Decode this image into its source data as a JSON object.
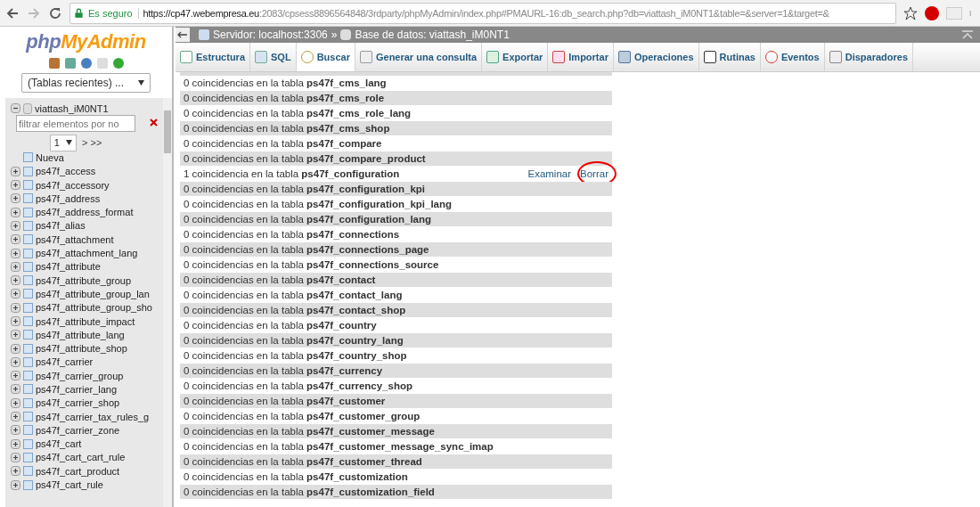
{
  "browser": {
    "security": "Es seguro",
    "url_host": "https://cp47.webempresa.eu",
    "url_rest": ":2083/cpsess8896564848/3rdparty/phpMyAdmin/index.php#PMAURL-16:db_search.php?db=viattash_iM0NT1&table=&server=1&target=&"
  },
  "sidebar": {
    "logo": {
      "prefix": "php",
      "main": "MyAdmin"
    },
    "recent": "(Tablas recientes) ...",
    "database": "viattash_iM0NT1",
    "expanded": true,
    "filter": {
      "placeholder": "filtrar elementos por no"
    },
    "page": "1",
    "page_nav": "> >>",
    "new_item": "Nueva",
    "tables": [
      "ps47f_access",
      "ps47f_accessory",
      "ps47f_address",
      "ps47f_address_format",
      "ps47f_alias",
      "ps47f_attachment",
      "ps47f_attachment_lang",
      "ps47f_attribute",
      "ps47f_attribute_group",
      "ps47f_attribute_group_lan",
      "ps47f_attribute_group_sho",
      "ps47f_attribute_impact",
      "ps47f_attribute_lang",
      "ps47f_attribute_shop",
      "ps47f_carrier",
      "ps47f_carrier_group",
      "ps47f_carrier_lang",
      "ps47f_carrier_shop",
      "ps47f_carrier_tax_rules_g",
      "ps47f_carrier_zone",
      "ps47f_cart",
      "ps47f_cart_cart_rule",
      "ps47f_cart_product",
      "ps47f_cart_rule"
    ]
  },
  "breadcrumb": {
    "server": "Servidor: localhost:3306",
    "separator": "»",
    "database": "Base de datos: viattash_iM0NT1"
  },
  "tabs": [
    {
      "label": "Estructura",
      "selected": false
    },
    {
      "label": "SQL",
      "selected": false
    },
    {
      "label": "Buscar",
      "selected": true
    },
    {
      "label": "Generar una consulta",
      "selected": false
    },
    {
      "label": "Exportar",
      "selected": false
    },
    {
      "label": "Importar",
      "selected": false
    },
    {
      "label": "Operaciones",
      "selected": false
    },
    {
      "label": "Rutinas",
      "selected": false
    },
    {
      "label": "Eventos",
      "selected": false
    },
    {
      "label": "Disparadores",
      "selected": false
    }
  ],
  "results": [
    {
      "text": "0 coincidencias en la tabla **ps47f_cms_lang**"
    },
    {
      "text": "0 coincidencias en la tabla **ps47f_cms_role**"
    },
    {
      "text": "0 coincidencias en la tabla **ps47f_cms_role_lang**"
    },
    {
      "text": "0 coincidencias en la tabla **ps47f_cms_shop**"
    },
    {
      "text": "0 coincidencias en la tabla **ps47f_compare**"
    },
    {
      "text": "0 coincidencias en la tabla **ps47f_compare_product**"
    },
    {
      "text": "1 coincidencia en la tabla **ps47f_configuration**",
      "browse": "Examinar",
      "delete": "Borrar",
      "circled": true
    },
    {
      "text": "0 coincidencias en la tabla **ps47f_configuration_kpi**"
    },
    {
      "text": "0 coincidencias en la tabla **ps47f_configuration_kpi_lang**"
    },
    {
      "text": "0 coincidencias en la tabla **ps47f_configuration_lang**"
    },
    {
      "text": "0 coincidencias en la tabla **ps47f_connections**"
    },
    {
      "text": "0 coincidencias en la tabla **ps47f_connections_page**"
    },
    {
      "text": "0 coincidencias en la tabla **ps47f_connections_source**"
    },
    {
      "text": "0 coincidencias en la tabla **ps47f_contact**"
    },
    {
      "text": "0 coincidencias en la tabla **ps47f_contact_lang**"
    },
    {
      "text": "0 coincidencias en la tabla **ps47f_contact_shop**"
    },
    {
      "text": "0 coincidencias en la tabla **ps47f_country**"
    },
    {
      "text": "0 coincidencias en la tabla **ps47f_country_lang**"
    },
    {
      "text": "0 coincidencias en la tabla **ps47f_country_shop**"
    },
    {
      "text": "0 coincidencias en la tabla **ps47f_currency**"
    },
    {
      "text": "0 coincidencias en la tabla **ps47f_currency_shop**"
    },
    {
      "text": "0 coincidencias en la tabla **ps47f_customer**"
    },
    {
      "text": "0 coincidencias en la tabla **ps47f_customer_group**"
    },
    {
      "text": "0 coincidencias en la tabla **ps47f_customer_message**"
    },
    {
      "text": "0 coincidencias en la tabla **ps47f_customer_message_sync_imap**"
    },
    {
      "text": "0 coincidencias en la tabla **ps47f_customer_thread**"
    },
    {
      "text": "0 coincidencias en la tabla **ps47f_customization**"
    },
    {
      "text": "0 coincidencias en la tabla **ps47f_customization_field**"
    }
  ]
}
